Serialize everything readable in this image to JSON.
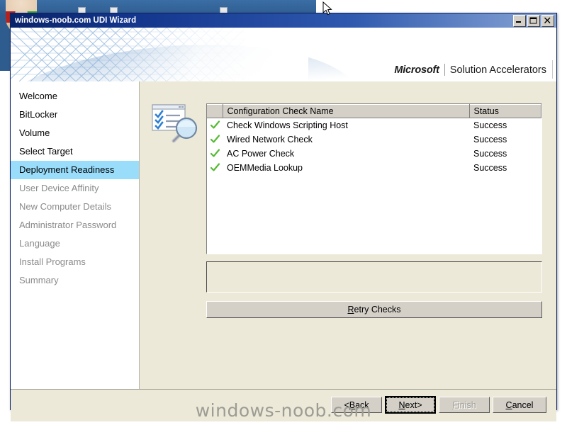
{
  "window": {
    "title": "windows-noob.com UDI Wizard",
    "minimize_label": "Minimize",
    "maximize_label": "Maximize",
    "close_label": "Close"
  },
  "banner": {
    "brand_primary": "Microsoft",
    "brand_secondary": "Solution Accelerators",
    "graphic_name": "blue-mesh-lattice"
  },
  "sidebar": {
    "items": [
      {
        "label": "Welcome",
        "state": "done"
      },
      {
        "label": "BitLocker",
        "state": "done"
      },
      {
        "label": "Volume",
        "state": "done"
      },
      {
        "label": "Select Target",
        "state": "done"
      },
      {
        "label": "Deployment Readiness",
        "state": "active"
      },
      {
        "label": "User Device Affinity",
        "state": "pending"
      },
      {
        "label": "New Computer Details",
        "state": "pending"
      },
      {
        "label": "Administrator Password",
        "state": "pending"
      },
      {
        "label": "Language",
        "state": "pending"
      },
      {
        "label": "Install Programs",
        "state": "pending"
      },
      {
        "label": "Summary",
        "state": "pending"
      }
    ]
  },
  "main": {
    "page_icon": "checklist-magnifier-icon",
    "table": {
      "columns": [
        "",
        "Configuration Check Name",
        "Status"
      ],
      "rows": [
        {
          "icon": "success-check-icon",
          "name": "Check Windows Scripting Host",
          "status": "Success"
        },
        {
          "icon": "success-check-icon",
          "name": "Wired Network Check",
          "status": "Success"
        },
        {
          "icon": "success-check-icon",
          "name": "AC Power Check",
          "status": "Success"
        },
        {
          "icon": "success-check-icon",
          "name": "OEMMedia Lookup",
          "status": "Success"
        }
      ]
    },
    "detail_panel_text": "",
    "retry_button": {
      "accel": "R",
      "rest": "etry Checks"
    }
  },
  "footer": {
    "back": {
      "prefix": "< ",
      "accel": "B",
      "rest": "ack"
    },
    "next": {
      "accel": "N",
      "rest": "ext",
      "suffix": " >"
    },
    "finish": {
      "accel": "F",
      "rest": "inish"
    },
    "cancel": {
      "accel": "C",
      "rest": "ancel"
    }
  },
  "watermark": {
    "text": "windows-noob.com"
  },
  "colors": {
    "titlebar_start": "#0a246a",
    "titlebar_end": "#8aa6d6",
    "dialog_face": "#ece9d8",
    "button_face": "#d4d0c8",
    "selection": "#99ddfb",
    "success_check": "#55bb33",
    "disabled_text": "#8b8b8b",
    "watermark_text": "#9c9c94"
  }
}
